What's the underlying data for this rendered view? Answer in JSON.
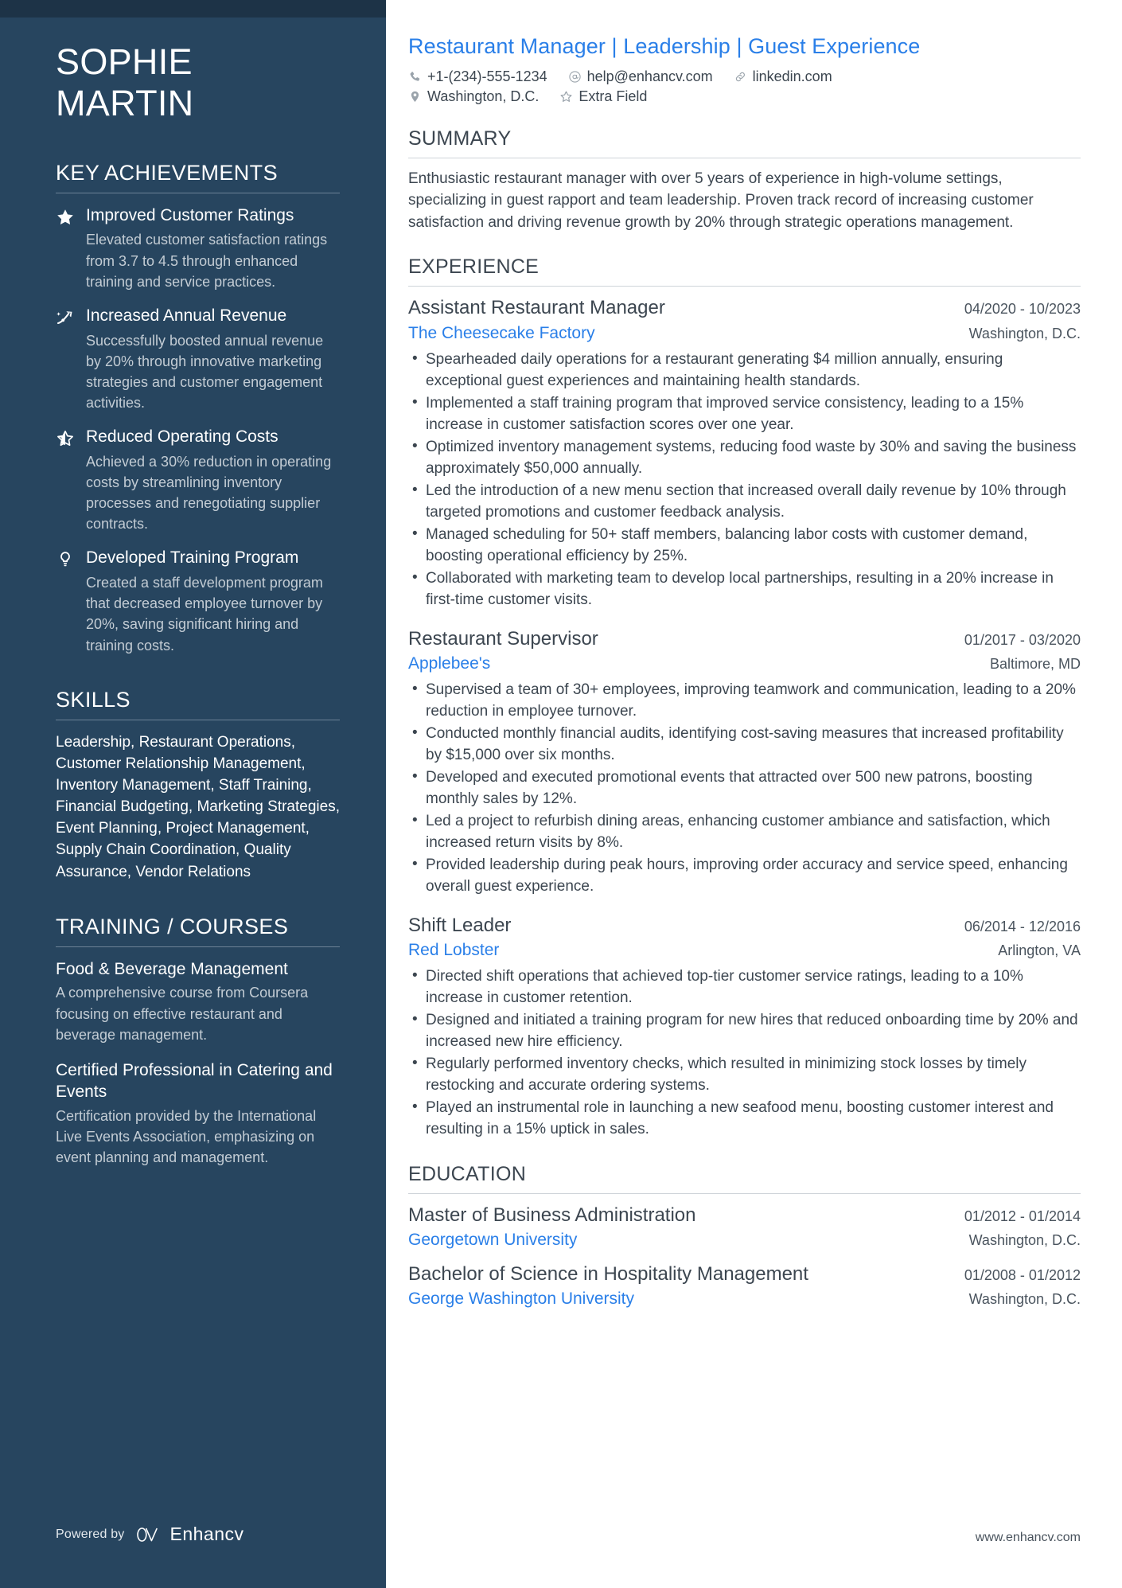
{
  "sidebar": {
    "name_lines": [
      "SOPHIE",
      "MARTIN"
    ],
    "achievements": {
      "heading": "KEY ACHIEVEMENTS",
      "items": [
        {
          "icon": "star-filled-icon",
          "title": "Improved Customer Ratings",
          "description": "Elevated customer satisfaction ratings from 3.7 to 4.5 through enhanced training and service practices."
        },
        {
          "icon": "trend-arrow-icon",
          "title": "Increased Annual Revenue",
          "description": "Successfully boosted annual revenue by 20% through innovative marketing strategies and customer engagement activities."
        },
        {
          "icon": "star-half-icon",
          "title": "Reduced Operating Costs",
          "description": "Achieved a 30% reduction in operating costs by streamlining inventory processes and renegotiating supplier contracts."
        },
        {
          "icon": "lightbulb-icon",
          "title": "Developed Training Program",
          "description": "Created a staff development program that decreased employee turnover by 20%, saving significant hiring and training costs."
        }
      ]
    },
    "skills": {
      "heading": "SKILLS",
      "text": "Leadership, Restaurant Operations, Customer Relationship Management, Inventory Management, Staff Training, Financial Budgeting, Marketing Strategies, Event Planning, Project Management, Supply Chain Coordination, Quality Assurance, Vendor Relations"
    },
    "training": {
      "heading": "TRAINING / COURSES",
      "items": [
        {
          "title": "Food & Beverage Management",
          "description": "A comprehensive course from Coursera focusing on effective restaurant and beverage management."
        },
        {
          "title": "Certified Professional in Catering and Events",
          "description": "Certification provided by the International Live Events Association, emphasizing on event planning and management."
        }
      ]
    },
    "footer": {
      "powered_by": "Powered by",
      "brand": "Enhancv"
    }
  },
  "main": {
    "headline": "Restaurant Manager | Leadership | Guest Experience",
    "contacts_row1": [
      {
        "icon": "phone-icon",
        "text": "+1-(234)-555-1234"
      },
      {
        "icon": "email-icon",
        "text": "help@enhancv.com"
      },
      {
        "icon": "link-icon",
        "text": "linkedin.com"
      }
    ],
    "contacts_row2": [
      {
        "icon": "location-pin-icon",
        "text": "Washington, D.C."
      },
      {
        "icon": "star-outline-icon",
        "text": "Extra Field"
      }
    ],
    "summary": {
      "heading": "SUMMARY",
      "text": "Enthusiastic restaurant manager with over 5 years of experience in high-volume settings, specializing in guest rapport and team leadership. Proven track record of increasing customer satisfaction and driving revenue growth by 20% through strategic operations management."
    },
    "experience": {
      "heading": "EXPERIENCE",
      "entries": [
        {
          "title": "Assistant Restaurant Manager",
          "dates": "04/2020 - 10/2023",
          "company": "The Cheesecake Factory",
          "location": "Washington, D.C.",
          "bullets": [
            "Spearheaded daily operations for a restaurant generating $4 million annually, ensuring exceptional guest experiences and maintaining health standards.",
            "Implemented a staff training program that improved service consistency, leading to a 15% increase in customer satisfaction scores over one year.",
            "Optimized inventory management systems, reducing food waste by 30% and saving the business approximately $50,000 annually.",
            "Led the introduction of a new menu section that increased overall daily revenue by 10% through targeted promotions and customer feedback analysis.",
            "Managed scheduling for 50+ staff members, balancing labor costs with customer demand, boosting operational efficiency by 25%.",
            "Collaborated with marketing team to develop local partnerships, resulting in a 20% increase in first-time customer visits."
          ]
        },
        {
          "title": "Restaurant Supervisor",
          "dates": "01/2017 - 03/2020",
          "company": "Applebee's",
          "location": "Baltimore, MD",
          "bullets": [
            "Supervised a team of 30+ employees, improving teamwork and communication, leading to a 20% reduction in employee turnover.",
            "Conducted monthly financial audits, identifying cost-saving measures that increased profitability by $15,000 over six months.",
            "Developed and executed promotional events that attracted over 500 new patrons, boosting monthly sales by 12%.",
            "Led a project to refurbish dining areas, enhancing customer ambiance and satisfaction, which increased return visits by 8%.",
            "Provided leadership during peak hours, improving order accuracy and service speed, enhancing overall guest experience."
          ]
        },
        {
          "title": "Shift Leader",
          "dates": "06/2014 - 12/2016",
          "company": "Red Lobster",
          "location": "Arlington, VA",
          "bullets": [
            "Directed shift operations that achieved top-tier customer service ratings, leading to a 10% increase in customer retention.",
            "Designed and initiated a training program for new hires that reduced onboarding time by 20% and increased new hire efficiency.",
            "Regularly performed inventory checks, which resulted in minimizing stock losses by timely restocking and accurate ordering systems.",
            "Played an instrumental role in launching a new seafood menu, boosting customer interest and resulting in a 15% uptick in sales."
          ]
        }
      ]
    },
    "education": {
      "heading": "EDUCATION",
      "entries": [
        {
          "degree": "Master of Business Administration",
          "dates": "01/2012 - 01/2014",
          "school": "Georgetown University",
          "location": "Washington, D.C."
        },
        {
          "degree": "Bachelor of Science in Hospitality Management",
          "dates": "01/2008 - 01/2012",
          "school": "George Washington University",
          "location": "Washington, D.C."
        }
      ]
    },
    "footer_url": "www.enhancv.com"
  },
  "colors": {
    "sidebar_bg": "#27455f",
    "sidebar_topbar": "#1d3347",
    "accent_blue": "#2a7fe8",
    "body_text": "#3c4650"
  }
}
